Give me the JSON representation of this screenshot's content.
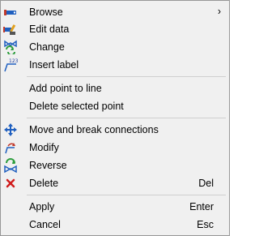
{
  "menu": {
    "items": [
      {
        "label": "Browse",
        "icon": "browse-icon",
        "submenu": true
      },
      {
        "label": "Edit data",
        "icon": "edit-data-icon"
      },
      {
        "label": "Change",
        "icon": "change-icon"
      },
      {
        "label": "Insert label",
        "icon": "insert-label-icon"
      },
      {
        "label": "Add point to line"
      },
      {
        "label": "Delete selected point"
      },
      {
        "label": "Move and break connections",
        "icon": "move-icon"
      },
      {
        "label": "Modify",
        "icon": "modify-icon"
      },
      {
        "label": "Reverse",
        "icon": "reverse-icon"
      },
      {
        "label": "Delete",
        "icon": "delete-icon",
        "shortcut": "Del"
      },
      {
        "label": "Apply",
        "shortcut": "Enter"
      },
      {
        "label": "Cancel",
        "shortcut": "Esc"
      }
    ],
    "insert_label_icon_text": "123",
    "submenu_arrow": "›"
  }
}
